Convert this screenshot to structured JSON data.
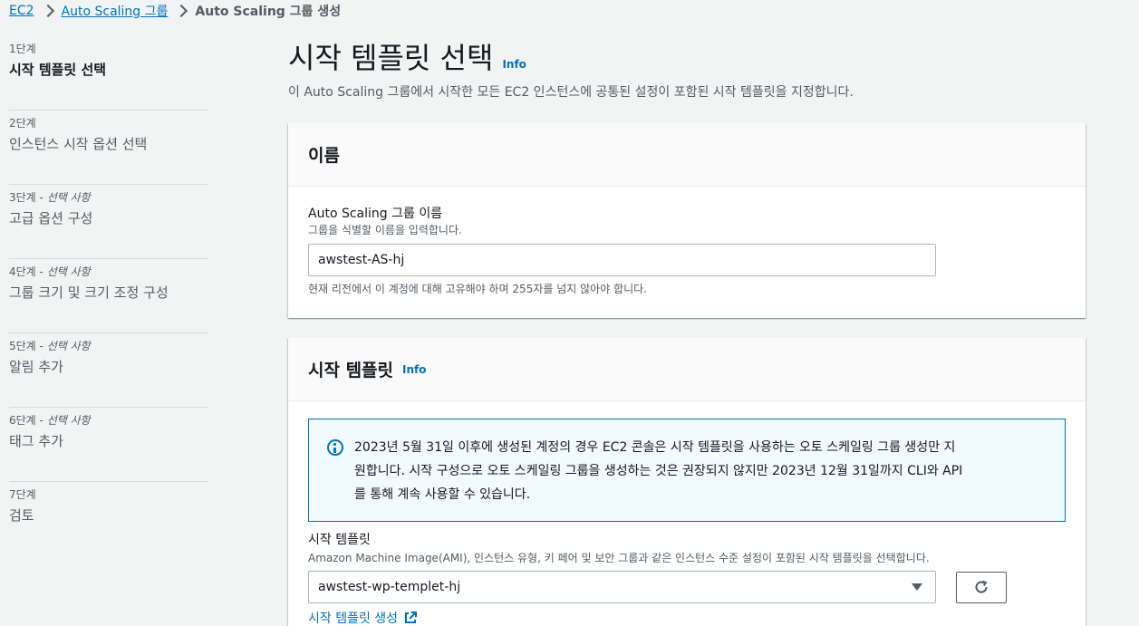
{
  "breadcrumb": {
    "items": [
      "EC2",
      "Auto Scaling 그룹"
    ],
    "current": "Auto Scaling 그룹 생성"
  },
  "steps": [
    {
      "num": "1단계",
      "optional": "",
      "title": "시작 템플릿 선택"
    },
    {
      "num": "2단계",
      "optional": "",
      "title": "인스턴스 시작 옵션 선택"
    },
    {
      "num": "3단계 - ",
      "optional": "선택 사항",
      "title": "고급 옵션 구성"
    },
    {
      "num": "4단계 - ",
      "optional": "선택 사항",
      "title": "그룹 크기 및 크기 조정 구성"
    },
    {
      "num": "5단계 - ",
      "optional": "선택 사항",
      "title": "알림 추가"
    },
    {
      "num": "6단계 - ",
      "optional": "선택 사항",
      "title": "태그 추가"
    },
    {
      "num": "7단계",
      "optional": "",
      "title": "검토"
    }
  ],
  "header": {
    "title": "시작 템플릿 선택",
    "info": "Info",
    "description": "이 Auto Scaling 그룹에서 시작한 모든 EC2 인스턴스에 공통된 설정이 포함된 시작 템플릿을 지정합니다."
  },
  "name_panel": {
    "heading": "이름",
    "label": "Auto Scaling 그룹 이름",
    "description": "그룹을 식별할 이름을 입력합니다.",
    "value": "awstest-AS-hj",
    "constraint": "현재 리전에서 이 계정에 대해 고유해야 하며 255자를 넘지 않아야 합니다."
  },
  "template_panel": {
    "heading": "시작 템플릿",
    "info": "Info",
    "alert_line1": "2023년 5월 31일 이후에 생성된 계정의 경우 EC2 콘솔은 시작 템플릿을 사용하는 오토 스케일링 그룹 생성만 지",
    "alert_line2": "원합니다. 시작 구성으로 오토 스케일링 그룹을 생성하는 것은 권장되지 않지만 2023년 12월 31일까지 CLI와 API",
    "alert_line3": "를 통해 계속 사용할 수 있습니다.",
    "label": "시작 템플릿",
    "description": "Amazon Machine Image(AMI), 인스턴스 유형, 키 페어 및 보안 그룹과 같은 인스턴스 수준 설정이 포함된 시작 템플릿을 선택합니다.",
    "selected": "awstest-wp-templet-hj",
    "create_link": "시작 템플릿 생성"
  },
  "colors": {
    "link": "#0073bb",
    "background": "#f2f3f3",
    "alert_bg": "#f1faff"
  }
}
